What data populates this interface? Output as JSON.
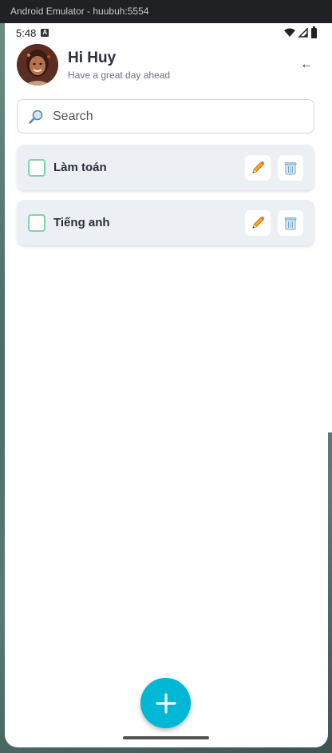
{
  "window": {
    "title": "Android Emulator - huubuh:5554"
  },
  "status_bar": {
    "time": "5:48",
    "notification_badge": "A"
  },
  "header": {
    "greeting": "Hi Huy",
    "subtitle": "Have a great day ahead",
    "back_symbol": "←"
  },
  "search": {
    "placeholder": "Search",
    "value": ""
  },
  "todos": [
    {
      "label": "Làm toán",
      "checked": false
    },
    {
      "label": "Tiếng anh",
      "checked": false
    }
  ],
  "colors": {
    "accent": "#00b7d6",
    "checkbox_border": "#7fd3a8",
    "card_bg": "#eceff3",
    "text_primary": "#2b2f3a"
  },
  "icons": [
    "search-icon",
    "edit-pencil-icon",
    "trash-icon",
    "plus-icon",
    "back-arrow-icon",
    "wifi-icon",
    "signal-icon",
    "battery-icon"
  ]
}
